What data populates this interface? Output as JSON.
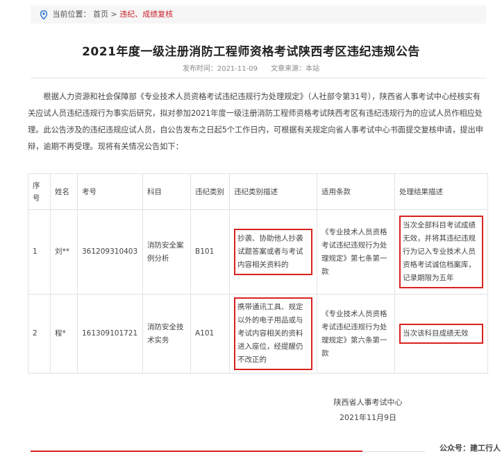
{
  "breadcrumb": {
    "prefix": "当前位置：",
    "home": "首页",
    "sep": " > ",
    "current": "违纪、成绩复核"
  },
  "article": {
    "title": "2021年度一级注册消防工程师资格考试陕西考区违纪违规公告",
    "publish_label": "发布时间：",
    "publish_date": "2021-11-09",
    "source_label": "文章来源：",
    "source": "本站",
    "intro": "根据人力资源和社会保障部《专业技术人员资格考试违纪违规行为处理规定》（人社部令第31号），陕西省人事考试中心经核实有关应试人员违纪违规行为事实后研究，拟对参加2021年度一级注册消防工程师资格考试陕西考区有违纪违规行为的应试人员作相应处理。此公告涉及的违纪违规应试人员，自公告发布之日起5个工作日内，可根据有关规定向省人事考试中心书面提交复核申请，提出申辩，逾期不再受理。现将有关情况公告如下："
  },
  "table": {
    "headers": {
      "seq": "序号",
      "name": "姓名",
      "exam_no": "考号",
      "subject": "科目",
      "category": "违纪类别",
      "desc": "违纪类别描述",
      "clause": "适用条款",
      "result": "处理结果描述"
    },
    "rows": [
      {
        "seq": "1",
        "name": "刘**",
        "exam_no": "361209310403",
        "subject": "消防安全案例分析",
        "category": "B101",
        "desc": "抄袭、协助他人抄袭试题答案或者与考试内容相关资料的",
        "clause": "《专业技术人员资格考试违纪违规行为处理规定》第七条第一款",
        "result": "当次全部科目考试成绩无效，并将其违纪违规行为记入专业技术人员资格考试诚信档案库，记录期限为五年"
      },
      {
        "seq": "2",
        "name": "程*",
        "exam_no": "161309101721",
        "subject": "消防安全技术实务",
        "category": "A101",
        "desc": "携带通讯工具、规定以外的电子用品或与考试内容相关的资料进入座位，经提醒仍不改正的",
        "clause": "《专业技术人员资格考试违纪违规行为处理规定》第六条第一款",
        "result": "当次该科目成绩无效"
      }
    ]
  },
  "footer": {
    "org": "陕西省人事考试中心",
    "date": "2021年11月9日"
  },
  "watermark": "公众号：建工行人",
  "colors": {
    "accent": "#d9201f",
    "breadcrumb_bg": "#f6f6f6"
  }
}
